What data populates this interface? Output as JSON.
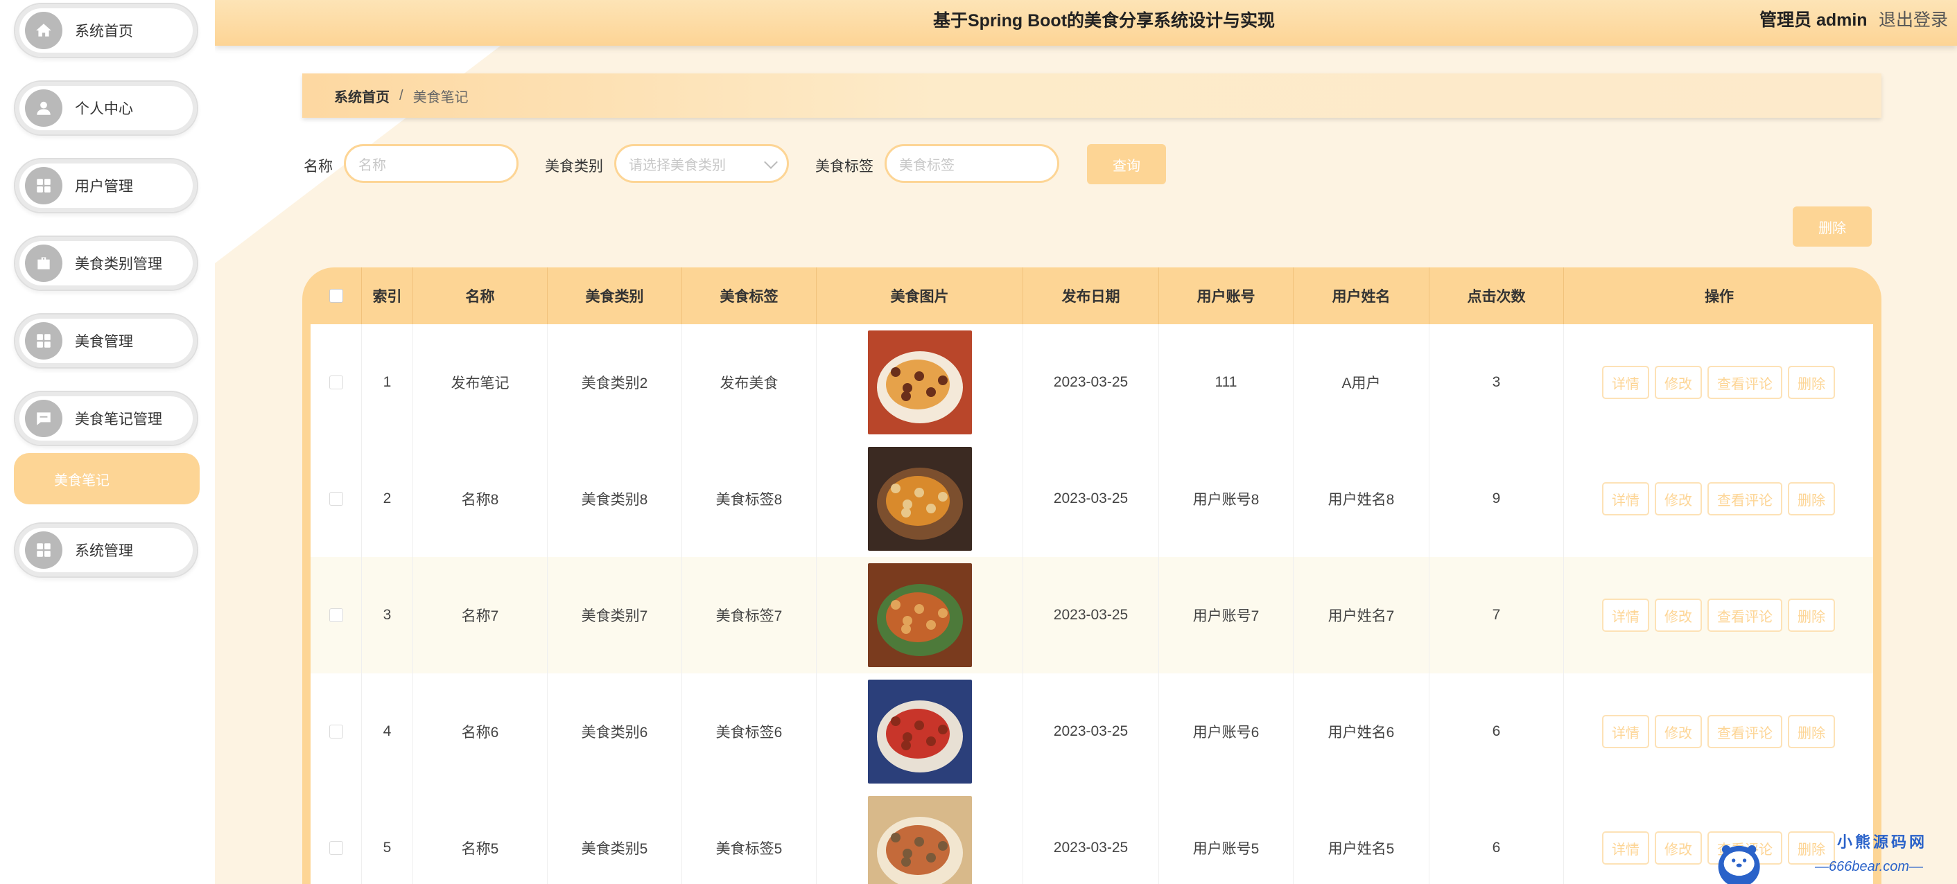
{
  "sidebar": {
    "items": [
      {
        "label": "系统首页",
        "icon": "home-icon"
      },
      {
        "label": "个人中心",
        "icon": "user-icon"
      },
      {
        "label": "用户管理",
        "icon": "grid-icon"
      },
      {
        "label": "美食类别管理",
        "icon": "briefcase-icon"
      },
      {
        "label": "美食管理",
        "icon": "grid-icon"
      },
      {
        "label": "美食笔记管理",
        "icon": "chat-icon"
      },
      {
        "label": "系统管理",
        "icon": "grid-icon"
      }
    ],
    "active_sub": "美食笔记"
  },
  "header": {
    "title": "基于Spring Boot的美食分享系统设计与实现",
    "admin": "管理员 admin",
    "logout": "退出登录"
  },
  "breadcrumb": {
    "home": "系统首页",
    "sep": "/",
    "current": "美食笔记"
  },
  "filters": {
    "name_label": "名称",
    "name_placeholder": "名称",
    "category_label": "美食类别",
    "category_placeholder": "请选择美食类别",
    "tag_label": "美食标签",
    "tag_placeholder": "美食标签",
    "search_button": "查询",
    "delete_button": "删除"
  },
  "table": {
    "headers": [
      "索引",
      "名称",
      "美食类别",
      "美食标签",
      "美食图片",
      "发布日期",
      "用户账号",
      "用户姓名",
      "点击次数",
      "操作"
    ],
    "actions": [
      "详情",
      "修改",
      "查看评论",
      "删除"
    ],
    "rows": [
      {
        "index": "1",
        "name": "发布笔记",
        "category": "美食类别2",
        "tag": "发布美食",
        "date": "2023-03-25",
        "account": "111",
        "username": "A用户",
        "clicks": "3"
      },
      {
        "index": "2",
        "name": "名称8",
        "category": "美食类别8",
        "tag": "美食标签8",
        "date": "2023-03-25",
        "account": "用户账号8",
        "username": "用户姓名8",
        "clicks": "9"
      },
      {
        "index": "3",
        "name": "名称7",
        "category": "美食类别7",
        "tag": "美食标签7",
        "date": "2023-03-25",
        "account": "用户账号7",
        "username": "用户姓名7",
        "clicks": "7"
      },
      {
        "index": "4",
        "name": "名称6",
        "category": "美食类别6",
        "tag": "美食标签6",
        "date": "2023-03-25",
        "account": "用户账号6",
        "username": "用户姓名6",
        "clicks": "6"
      },
      {
        "index": "5",
        "name": "名称5",
        "category": "美食类别5",
        "tag": "美食标签5",
        "date": "2023-03-25",
        "account": "用户账号5",
        "username": "用户姓名5",
        "clicks": "6"
      }
    ]
  },
  "watermark": {
    "line1": "小熊源码网",
    "line2": "—666bear.com—"
  },
  "colors": {
    "accent": "#fdd595",
    "header_bg": "#fde4b6",
    "page_bg": "#fdf3e2"
  }
}
